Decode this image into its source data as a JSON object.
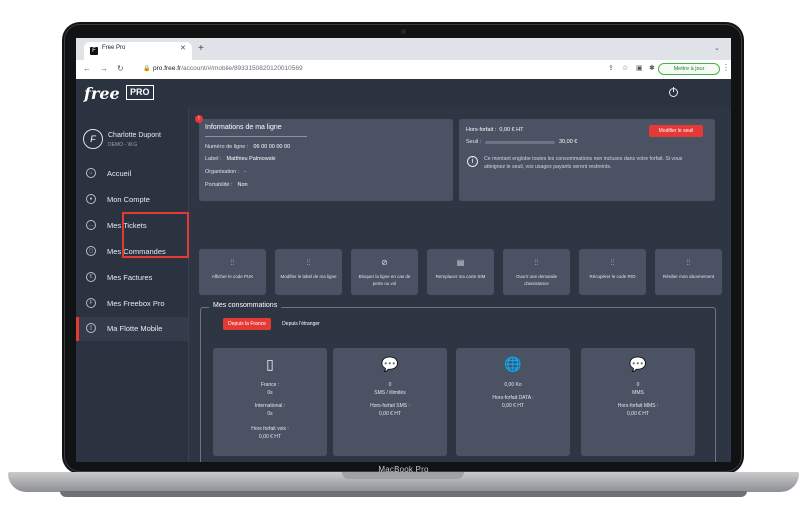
{
  "laptop": {
    "brand": "MacBook Pro"
  },
  "browser": {
    "tab_title": "Free Pro",
    "favicon": "F",
    "url_host": "pro.free.fr",
    "url_path": "/account/#/mobile/89331508201200105​69",
    "update_label": "Mettre à jour"
  },
  "app": {
    "logo": "free",
    "logo_badge": "PRO"
  },
  "user": {
    "name": "Charlotte Dupont",
    "sub": "DEMO - W.G",
    "avatar": "F"
  },
  "sidebar": {
    "items": [
      {
        "label": "Accueil",
        "icon": "home-icon",
        "glyph": "⌂"
      },
      {
        "label": "Mon Compte",
        "icon": "user-icon",
        "glyph": "●"
      },
      {
        "label": "Mes Tickets",
        "icon": "chat-icon",
        "glyph": "…"
      },
      {
        "label": "Mes Commandes",
        "icon": "box-icon",
        "glyph": "▢"
      },
      {
        "label": "Mes Factures",
        "icon": "invoice-icon",
        "glyph": "€"
      },
      {
        "label": "Mes Freebox Pro",
        "icon": "freebox-icon",
        "glyph": "F"
      },
      {
        "label": "Ma Flotte Mobile",
        "icon": "mobile-icon",
        "glyph": "▯"
      }
    ]
  },
  "line_info": {
    "badge": "!",
    "title": "Informations de ma ligne",
    "rows": [
      {
        "label": "Numéro de ligne :",
        "value": "06 00 00 00 00"
      },
      {
        "label": "Label :",
        "value": "Matthieu Palmowski"
      },
      {
        "label": "Organisation :",
        "value": "-"
      },
      {
        "label": "Portabilité :",
        "value": "Non"
      }
    ]
  },
  "hors_forfait": {
    "label": "Hors-forfait :",
    "value": "0,00 € HT",
    "seuil_label": "Seuil :",
    "seuil_value": "30,00 €",
    "progress": 0,
    "button": "Modifier le seuil",
    "note": "Ce montant englobe toutes les consommations non incluses dans votre forfait. Si vous atteignez le seuil, vos usages payants seront restreints."
  },
  "actions": [
    {
      "label": "Afficher le code PUK",
      "icon": "settings-icon"
    },
    {
      "label": "Modifier le label de ma ligne",
      "icon": "settings-icon"
    },
    {
      "label": "Bloquer la ligne en cas de perte ou vol",
      "icon": "block-icon"
    },
    {
      "label": "Remplacer ma carte SIM",
      "icon": "sim-icon"
    },
    {
      "label": "Ouvrir une demande d'assistance",
      "icon": "settings-icon"
    },
    {
      "label": "Récupérer le code RIO",
      "icon": "settings-icon"
    },
    {
      "label": "Résilier mon abonnement",
      "icon": "settings-icon"
    }
  ],
  "conso": {
    "title": "Mes consommations",
    "tabs": [
      "Depuis la France",
      "Depuis l'étranger"
    ],
    "cards": [
      {
        "icon": "phone-icon",
        "glyph": "▯",
        "lines": [
          "France :",
          "0s",
          "International :",
          "0s",
          "Hors forfait voix :",
          "0,00 € HT"
        ]
      },
      {
        "icon": "sms-icon",
        "glyph": "💬",
        "lines": [
          "0",
          "SMS / illimités",
          "Hors-forfait SMS :",
          "0,00 € HT"
        ]
      },
      {
        "icon": "globe-icon",
        "glyph": "🌐",
        "lines": [
          "0,00 Ko",
          "Hors-forfait DATA :",
          "0,00 € HT"
        ]
      },
      {
        "icon": "mms-icon",
        "glyph": "💬",
        "lines": [
          "0",
          "MMS",
          "Hors-forfait MMS :",
          "0,00 € HT"
        ]
      }
    ]
  }
}
